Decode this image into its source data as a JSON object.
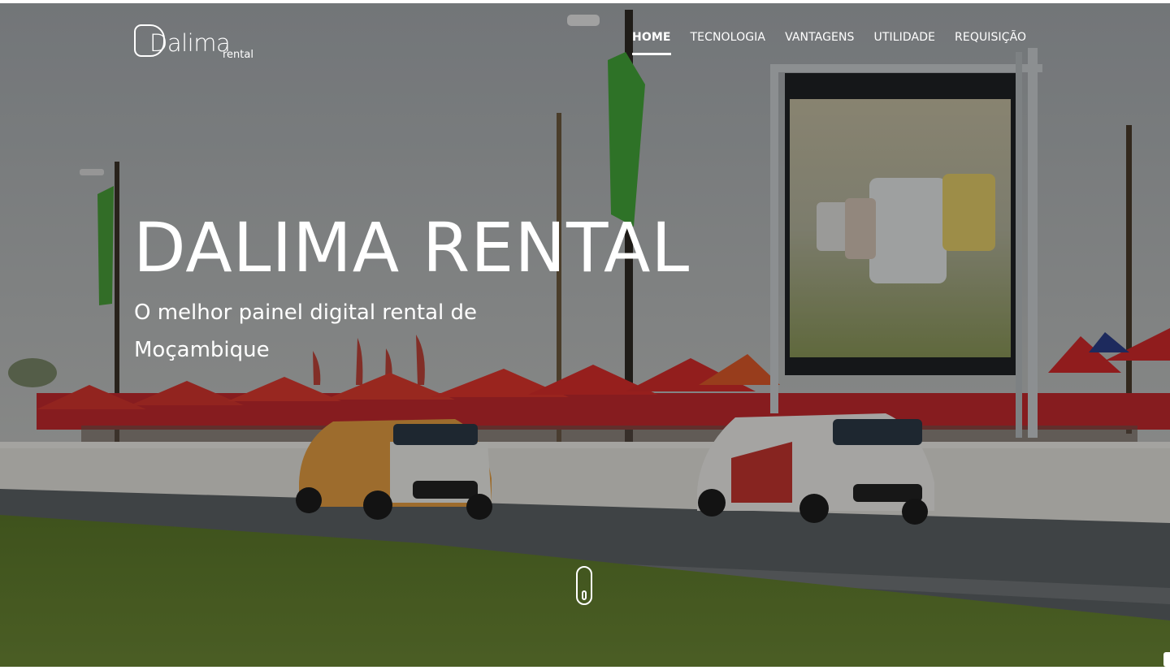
{
  "brand": {
    "logo_text": "Dalima",
    "logo_sub": "rental"
  },
  "nav": {
    "items": [
      {
        "label": "HOME",
        "active": true
      },
      {
        "label": "TECNOLOGIA",
        "active": false
      },
      {
        "label": "VANTAGENS",
        "active": false
      },
      {
        "label": "UTILIDADE",
        "active": false
      },
      {
        "label": "REQUISIÇÃO",
        "active": false
      }
    ]
  },
  "hero": {
    "title": "DALIMA RENTAL",
    "subtitle": "O melhor painel digital rental de Moçambique"
  },
  "colors": {
    "accent": "#ffffff",
    "tent_red": "#d8252b",
    "grass": "#5f7f2e"
  },
  "icons": {
    "scroll": "mouse-scroll-icon"
  }
}
